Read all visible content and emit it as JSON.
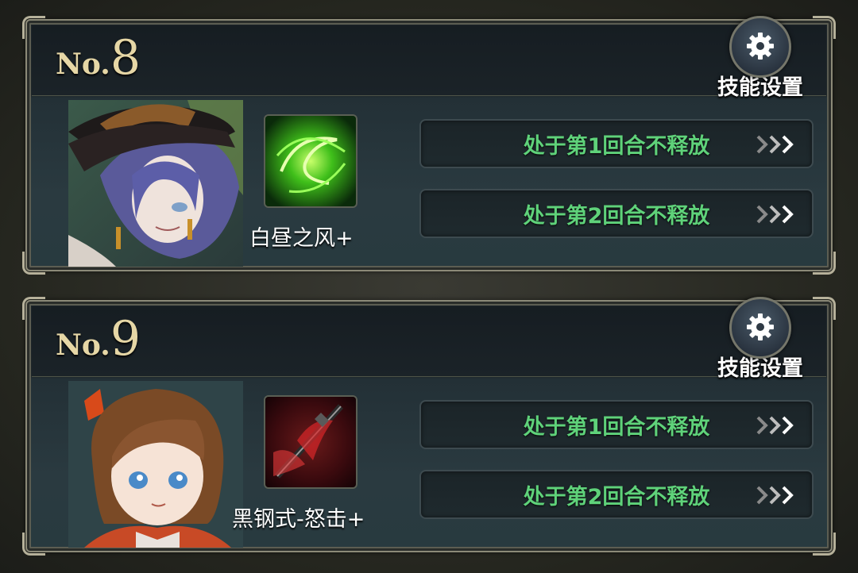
{
  "cards": [
    {
      "no_prefix": "No.",
      "no_number": "8",
      "settings_label": "技能设置",
      "skill_name": "白昼之风+",
      "skill_color": "#4ad12a",
      "actions": [
        {
          "label": "处于第1回合不释放"
        },
        {
          "label": "处于第2回合不释放"
        }
      ]
    },
    {
      "no_prefix": "No.",
      "no_number": "9",
      "settings_label": "技能设置",
      "skill_name": "黑钢式-怒击+",
      "skill_color": "#c8242a",
      "actions": [
        {
          "label": "处于第1回合不释放"
        },
        {
          "label": "处于第2回合不释放"
        }
      ]
    }
  ],
  "icons": {
    "settings": "gear-icon",
    "advance": "triple-chevron-right-icon"
  },
  "colors": {
    "action_text": "#5fd27a",
    "gold": "#e6d7a6",
    "frame": "#8c8a78"
  }
}
